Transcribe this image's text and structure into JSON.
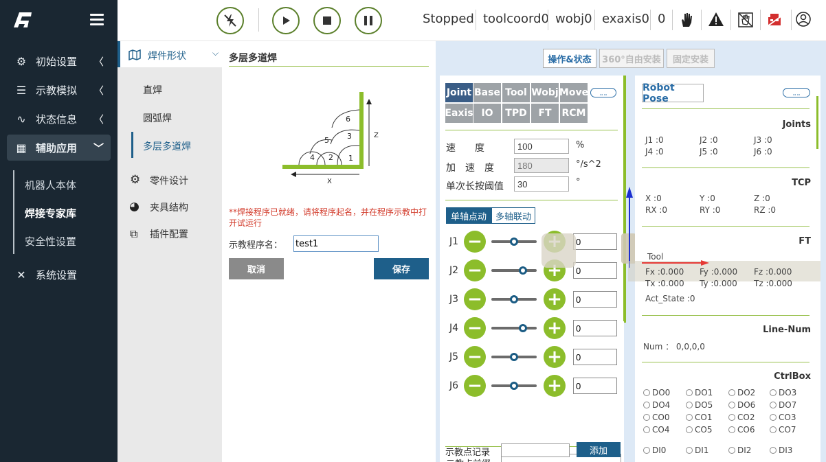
{
  "sidebar": {
    "items": [
      {
        "label": "初始设置",
        "icon": "gear-icon"
      },
      {
        "label": "示教模拟",
        "icon": "list-icon"
      },
      {
        "label": "状态信息",
        "icon": "pulse-icon"
      },
      {
        "label": "辅助应用",
        "icon": "grid-icon"
      },
      {
        "label": "系统设置",
        "icon": "tools-icon"
      }
    ],
    "sub_items": [
      "机器人本体",
      "焊接专家库",
      "安全性设置"
    ]
  },
  "topbar": {
    "status": "Stopped",
    "toolcoord": "toolcoord0",
    "wobj": "wobj0",
    "exaxis": "exaxis0",
    "count": "0"
  },
  "panel2": {
    "header": "焊件形状",
    "items": [
      "直焊",
      "圆弧焊",
      "多层多道焊"
    ],
    "menu": [
      "零件设计",
      "夹具结构",
      "插件配置"
    ]
  },
  "center": {
    "title": "多层多道焊",
    "diagram": {
      "labels": [
        "1",
        "2",
        "3",
        "4",
        "5",
        "6"
      ],
      "axis_x": "X",
      "axis_z": "Z"
    },
    "warning": "**焊接程序已就绪，请将程序起名，并在程序示教中打开试运行",
    "name_label": "示教程序名：",
    "name_value": "test1",
    "cancel": "取消",
    "save": "保存"
  },
  "right": {
    "mode_buttons": [
      "操作&状态",
      "360°自由安装",
      "固定安装"
    ],
    "tabs_row1": [
      "Joint",
      "Base",
      "Tool",
      "Wobj",
      "Move"
    ],
    "tabs_row2": [
      "Eaxis",
      "IO",
      "TPD",
      "FT",
      "RCM"
    ],
    "speed_label": "速　　度",
    "speed_value": "100",
    "speed_unit": "%",
    "acc_label": "加　速　度",
    "acc_value": "180",
    "acc_unit": "°/s^2",
    "thresh_label": "单次长按阈值",
    "thresh_value": "30",
    "thresh_unit": "°",
    "mode_tabs": [
      "单轴点动",
      "多轴联动"
    ],
    "joints": [
      {
        "label": "J1",
        "value": "0",
        "pos": 0.5
      },
      {
        "label": "J2",
        "value": "0",
        "pos": 0.7
      },
      {
        "label": "J3",
        "value": "0",
        "pos": 0.5
      },
      {
        "label": "J4",
        "value": "0",
        "pos": 0.7
      },
      {
        "label": "J5",
        "value": "0",
        "pos": 0.5
      },
      {
        "label": "J6",
        "value": "0",
        "pos": 0.5
      }
    ],
    "prefix_label": "示教点前缀",
    "record_label": "示教点记录",
    "add_btn": "添加"
  },
  "robot_pose": {
    "title": "Robot Pose",
    "joints_title": "Joints",
    "joints": [
      "J1 :0",
      "J2 :0",
      "J3 :0",
      "J4 :0",
      "J5 :0",
      "J6 :0"
    ],
    "tcp_title": "TCP",
    "tcp": [
      "X :0",
      "Y :0",
      "Z :0",
      "RX :0",
      "RY :0",
      "RZ :0"
    ],
    "ft_title": "FT",
    "tool_label": "Tool",
    "ft": [
      "Fx :0.000",
      "Fy :0.000",
      "Fz :0.000",
      "Tx :0.000",
      "Ty :0.000",
      "Tz :0.000"
    ],
    "act_state": "Act_State :0",
    "line_title": "Line-Num",
    "num": "Num ： 0,0,0,0",
    "ctrl_title": "CtrlBox",
    "ctrl": [
      "DO0",
      "DO1",
      "DO2",
      "DO3",
      "DO4",
      "DO5",
      "DO6",
      "DO7",
      "CO0",
      "CO1",
      "CO2",
      "CO3",
      "CO4",
      "CO5",
      "CO6",
      "CO7",
      "DI0",
      "DI1",
      "DI2",
      "DI3"
    ]
  }
}
